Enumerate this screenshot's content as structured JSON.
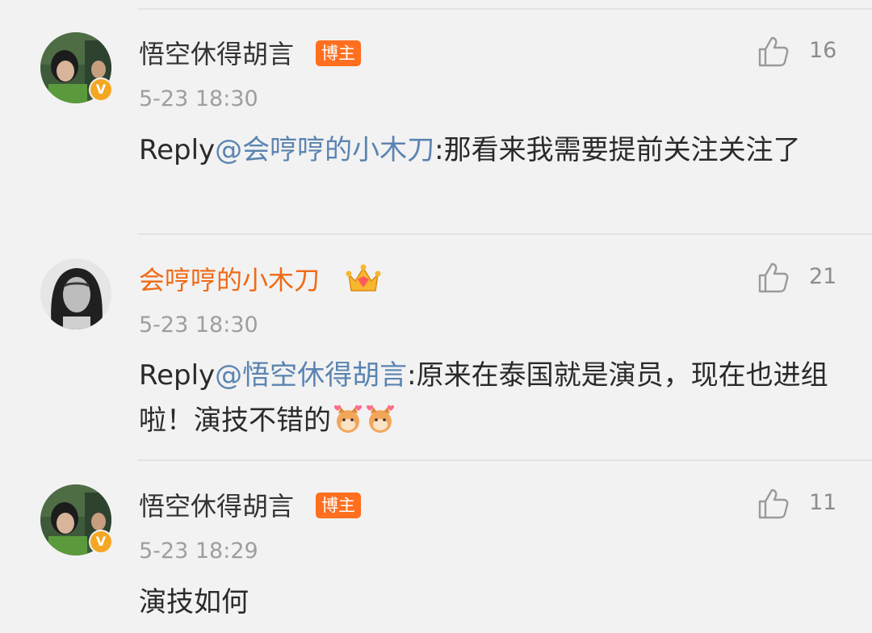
{
  "comments": [
    {
      "username": "悟空休得胡言",
      "badge": "博主",
      "verified_mark": "V",
      "time": "5-23 18:30",
      "likes": "16",
      "reply_prefix": "Reply",
      "mention": "@会哼哼的小木刀",
      "text": ":那看来我需要提前关注关注了",
      "avatar": "avatar-green-photo"
    },
    {
      "username": "会哼哼的小木刀",
      "badge_icon": "crown-icon",
      "time": "5-23 18:30",
      "likes": "21",
      "reply_prefix": "Reply",
      "mention": "@悟空休得胡言",
      "text": ":原来在泰国就是演员，现在也进组啦！演技不错的",
      "emojis": [
        "shiba-love-emoji",
        "shiba-love-emoji"
      ],
      "avatar": "avatar-bw-portrait"
    },
    {
      "username": "悟空休得胡言",
      "badge": "博主",
      "verified_mark": "V",
      "time": "5-23 18:29",
      "likes": "11",
      "text": "演技如何",
      "avatar": "avatar-green-photo"
    }
  ],
  "colors": {
    "background": "#f2f2f2",
    "mention": "#5b84b1",
    "vip_name": "#ef6a16",
    "badge": "#ff6f1f",
    "verified": "#f5a623",
    "muted": "#9e9e9e"
  }
}
